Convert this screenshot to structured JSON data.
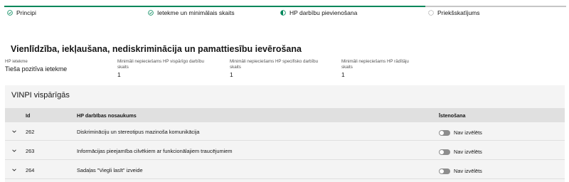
{
  "steps": [
    {
      "label": "Principi",
      "state": "done",
      "icon": "check-circle-icon"
    },
    {
      "label": "Ietekme un minimālais skaits",
      "state": "done",
      "icon": "check-circle-icon"
    },
    {
      "label": "HP darbību pievienošana",
      "state": "current",
      "icon": "half-circle-icon"
    },
    {
      "label": "Priekšskatījums",
      "state": "todo",
      "icon": "empty-circle-icon"
    }
  ],
  "section_title": "Vienlīdzība, iekļaušana, nediskriminācija un pamattiesību ievērošana",
  "metrics": {
    "impact_label": "HP ietekme",
    "impact_value": "Tieša pozitīva ietekme",
    "general_label": "Minimāli nepieciešams HP vispārīgo darbību skaits",
    "general_value": "1",
    "specific_label": "Minimāli nepieciešams HP specifisko darbību skaits",
    "specific_value": "1",
    "indicator_label": "Minimāli nepieciešams HP rādītāju skaits",
    "indicator_value": "1"
  },
  "panel": {
    "title": "VINPI vispārīgās",
    "columns": {
      "id": "Id",
      "name": "HP darbības nosaukums",
      "impl": "Īstenošana"
    },
    "rows": [
      {
        "id": "262",
        "name": "Diskrimināciju un stereotipus mazinoša komunikācija",
        "toggle_label": "Nav izvēlēts"
      },
      {
        "id": "263",
        "name": "Informācijas pieejamība cilvēkiem ar funkcionālajiem traucējumiem",
        "toggle_label": "Nav izvēlēts"
      },
      {
        "id": "264",
        "name": "Sadaļas \"Viegli lasīt\" izveide",
        "toggle_label": "Nav izvēlēts"
      }
    ]
  },
  "colors": {
    "accent": "#00875a",
    "toggle_off": "#8d8d8d",
    "panel_bg": "#f4f4f4",
    "header_bg": "#e0e0e0"
  }
}
